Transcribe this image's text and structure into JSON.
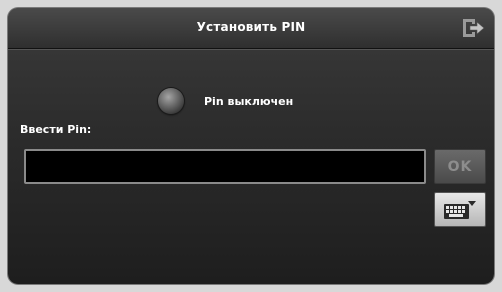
{
  "header": {
    "title": "Установить PIN",
    "exit_icon": "exit-icon"
  },
  "pin_status": {
    "indicator_icon": "status-led-icon",
    "state": "off",
    "label": "Pin выключен"
  },
  "pin_field": {
    "label": "Ввести Pin:",
    "value": "",
    "placeholder": ""
  },
  "buttons": {
    "ok_label": "OK",
    "ok_enabled": false,
    "keyboard_icon": "keyboard-icon"
  },
  "colors": {
    "background": "#2c2c2c",
    "text": "#ffffff",
    "disabled_text": "#8d8d8d"
  }
}
